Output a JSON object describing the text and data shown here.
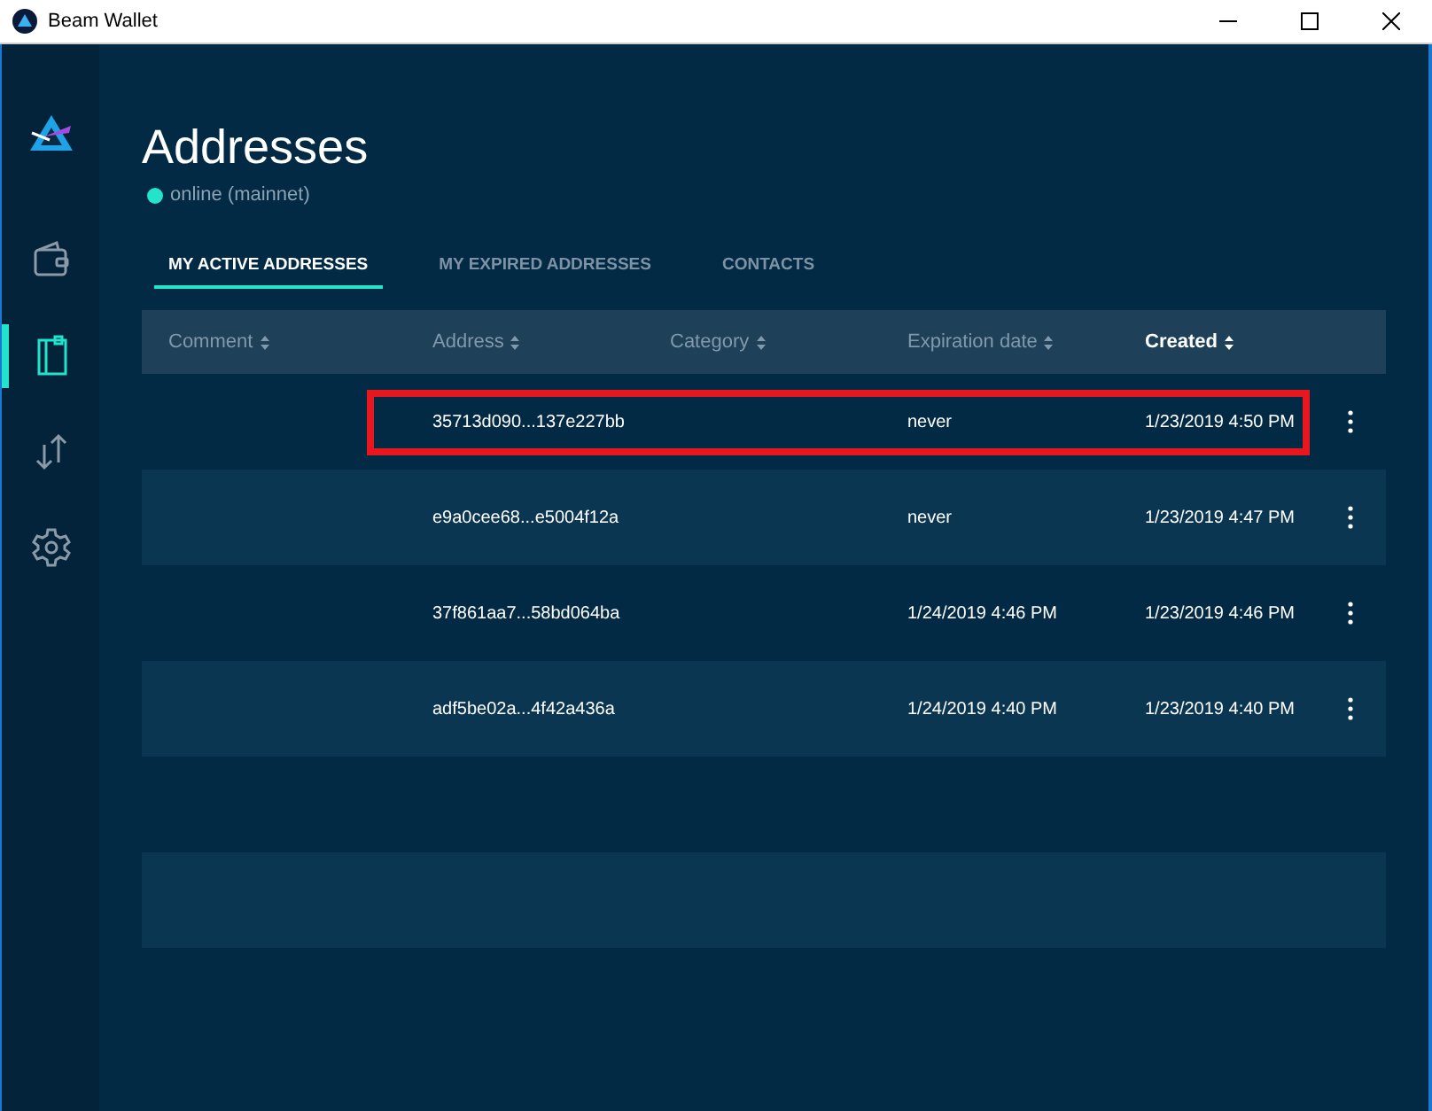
{
  "window": {
    "title": "Beam Wallet"
  },
  "sidebar": {
    "items": [
      {
        "kind": "wallet",
        "selected": false
      },
      {
        "kind": "addresses",
        "selected": true
      },
      {
        "kind": "transfer",
        "selected": false
      },
      {
        "kind": "settings",
        "selected": false
      }
    ]
  },
  "page": {
    "title": "Addresses",
    "status": "online (mainnet)"
  },
  "tabs": [
    {
      "label": "MY ACTIVE ADDRESSES",
      "selected": true
    },
    {
      "label": "MY EXPIRED ADDRESSES",
      "selected": false
    },
    {
      "label": "CONTACTS",
      "selected": false
    }
  ],
  "table": {
    "columns": [
      {
        "label": "Comment",
        "selected": false
      },
      {
        "label": "Address",
        "selected": false
      },
      {
        "label": "Category",
        "selected": false
      },
      {
        "label": "Expiration date",
        "selected": false
      },
      {
        "label": "Created",
        "selected": true
      }
    ],
    "rows": [
      {
        "address": "35713d090...137e227bb",
        "expiration": "never",
        "created": "1/23/2019 4:50 PM",
        "highlighted": true
      },
      {
        "address": "e9a0cee68...e5004f12a",
        "expiration": "never",
        "created": "1/23/2019 4:47 PM",
        "highlighted": false
      },
      {
        "address": "37f861aa7...58bd064ba",
        "expiration": "1/24/2019 4:46 PM",
        "created": "1/23/2019 4:46 PM",
        "highlighted": false
      },
      {
        "address": "adf5be02a...4f42a436a",
        "expiration": "1/24/2019 4:40 PM",
        "created": "1/23/2019 4:40 PM",
        "highlighted": false
      }
    ]
  }
}
